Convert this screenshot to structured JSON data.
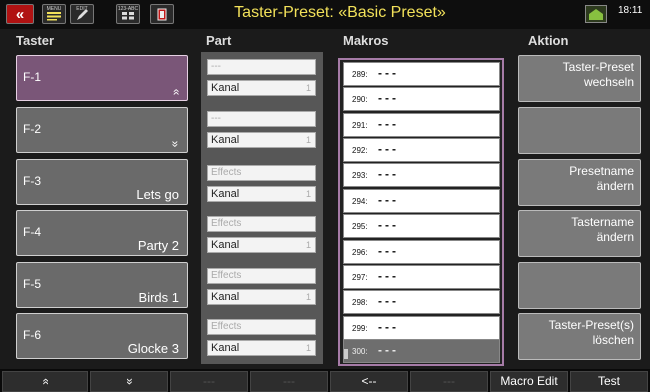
{
  "title": "Taster-Preset: «Basic Preset»",
  "clock": "18:11",
  "titlebar_icons": {
    "back": "«",
    "menu": "MENU",
    "edit": "EDIT",
    "multi": "123-ABC",
    "shift": "SHIFT"
  },
  "headers": {
    "taster": "Taster",
    "part": "Part",
    "makros": "Makros",
    "aktion": "Aktion"
  },
  "tasters": [
    {
      "name": "F-1",
      "preset": "",
      "arrow": "»"
    },
    {
      "name": "F-2",
      "preset": "",
      "arrow": "»"
    },
    {
      "name": "F-3",
      "preset": "Lets go",
      "arrow": ""
    },
    {
      "name": "F-4",
      "preset": "Party 2",
      "arrow": ""
    },
    {
      "name": "F-5",
      "preset": "Birds 1",
      "arrow": ""
    },
    {
      "name": "F-6",
      "preset": "Glocke 3",
      "arrow": ""
    }
  ],
  "parts": [
    {
      "top": "---",
      "bottom": "Kanal",
      "num": "1"
    },
    {
      "top": "---",
      "bottom": "Kanal",
      "num": "1"
    },
    {
      "top": "Effects",
      "bottom": "Kanal",
      "num": "1"
    },
    {
      "top": "Effects",
      "bottom": "Kanal",
      "num": "1"
    },
    {
      "top": "Effects",
      "bottom": "Kanal",
      "num": "1"
    },
    {
      "top": "Effects",
      "bottom": "Kanal",
      "num": "1"
    }
  ],
  "makros": [
    {
      "num": "289:",
      "val": "---"
    },
    {
      "num": "290:",
      "val": "---"
    },
    {
      "num": "291:",
      "val": "---"
    },
    {
      "num": "292:",
      "val": "---"
    },
    {
      "num": "293:",
      "val": "---"
    },
    {
      "num": "294:",
      "val": "---"
    },
    {
      "num": "295:",
      "val": "---"
    },
    {
      "num": "296:",
      "val": "---"
    },
    {
      "num": "297:",
      "val": "---"
    },
    {
      "num": "298:",
      "val": "---"
    },
    {
      "num": "299:",
      "val": "---"
    },
    {
      "num": "300:",
      "val": "---"
    }
  ],
  "aktionen": [
    "Taster-Preset\nwechseln",
    "",
    "Presetname\nändern",
    "Tastername\nändern",
    "",
    "Taster-Preset(s)\nlöschen"
  ],
  "bottom": [
    "»",
    "»",
    "---",
    "---",
    "<--",
    "---",
    "Macro Edit",
    "Test"
  ]
}
